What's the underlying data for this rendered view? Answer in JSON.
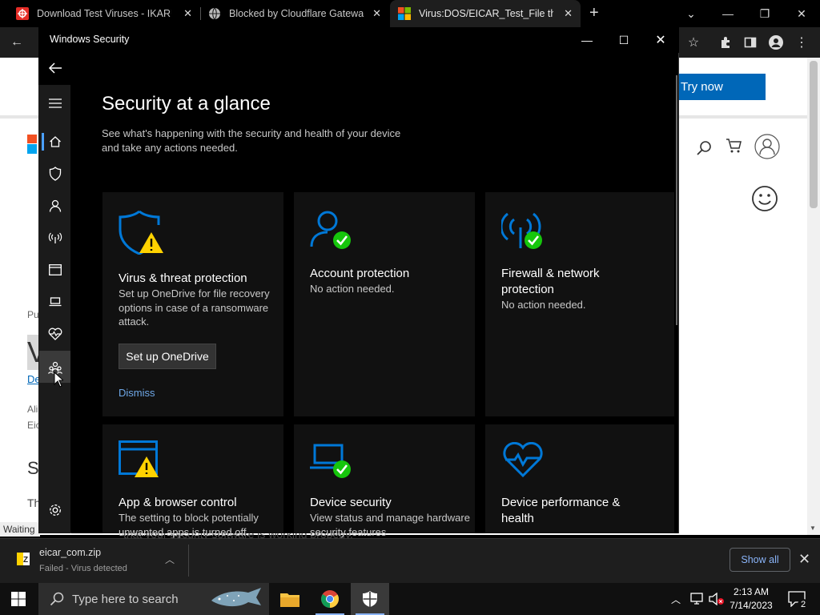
{
  "browser": {
    "tabs": [
      {
        "title": "Download Test Viruses - IKARUS",
        "close": "✕"
      },
      {
        "title": "Blocked by Cloudflare Gateway",
        "close": "✕"
      },
      {
        "title": "Virus:DOS/EICAR_Test_File threat",
        "close": "✕"
      }
    ],
    "new_tab": "+",
    "page": {
      "try_now": "Try now",
      "fragments": {
        "pu": "Pu",
        "v": "V",
        "de": "De",
        "ali": "Ali",
        "eic": "Eic",
        "s": "S",
        "th": "Th"
      },
      "waiting": "Waiting",
      "partial_text": "that your security software is working properly."
    }
  },
  "windows_security": {
    "window_title": "Windows Security",
    "heading": "Security at a glance",
    "subheading": "See what's happening with the security and health of your device and take any actions needed.",
    "cards": {
      "virus": {
        "title": "Virus & threat protection",
        "desc": "Set up OneDrive for file recovery options in case of a ransomware attack.",
        "button": "Set up OneDrive",
        "link": "Dismiss"
      },
      "account": {
        "title": "Account protection",
        "desc": "No action needed."
      },
      "firewall": {
        "title": "Firewall & network protection",
        "desc": "No action needed."
      },
      "app": {
        "title": "App & browser control",
        "desc": "The setting to block potentially unwanted apps is turned off."
      },
      "device_security": {
        "title": "Device security",
        "desc": "View status and manage hardware security features"
      },
      "performance": {
        "title": "Device performance & health",
        "desc": ""
      }
    },
    "colors": {
      "accent_blue": "#0078d7",
      "ok_green": "#16c60c",
      "warn_yellow": "#ffd200"
    }
  },
  "download_bar": {
    "file_name": "eicar_com.zip",
    "status": "Failed - Virus detected",
    "show_all": "Show all",
    "close": "✕"
  },
  "taskbar": {
    "search_placeholder": "Type here to search",
    "time": "2:13 AM",
    "date": "7/14/2023",
    "notifications": "2"
  }
}
